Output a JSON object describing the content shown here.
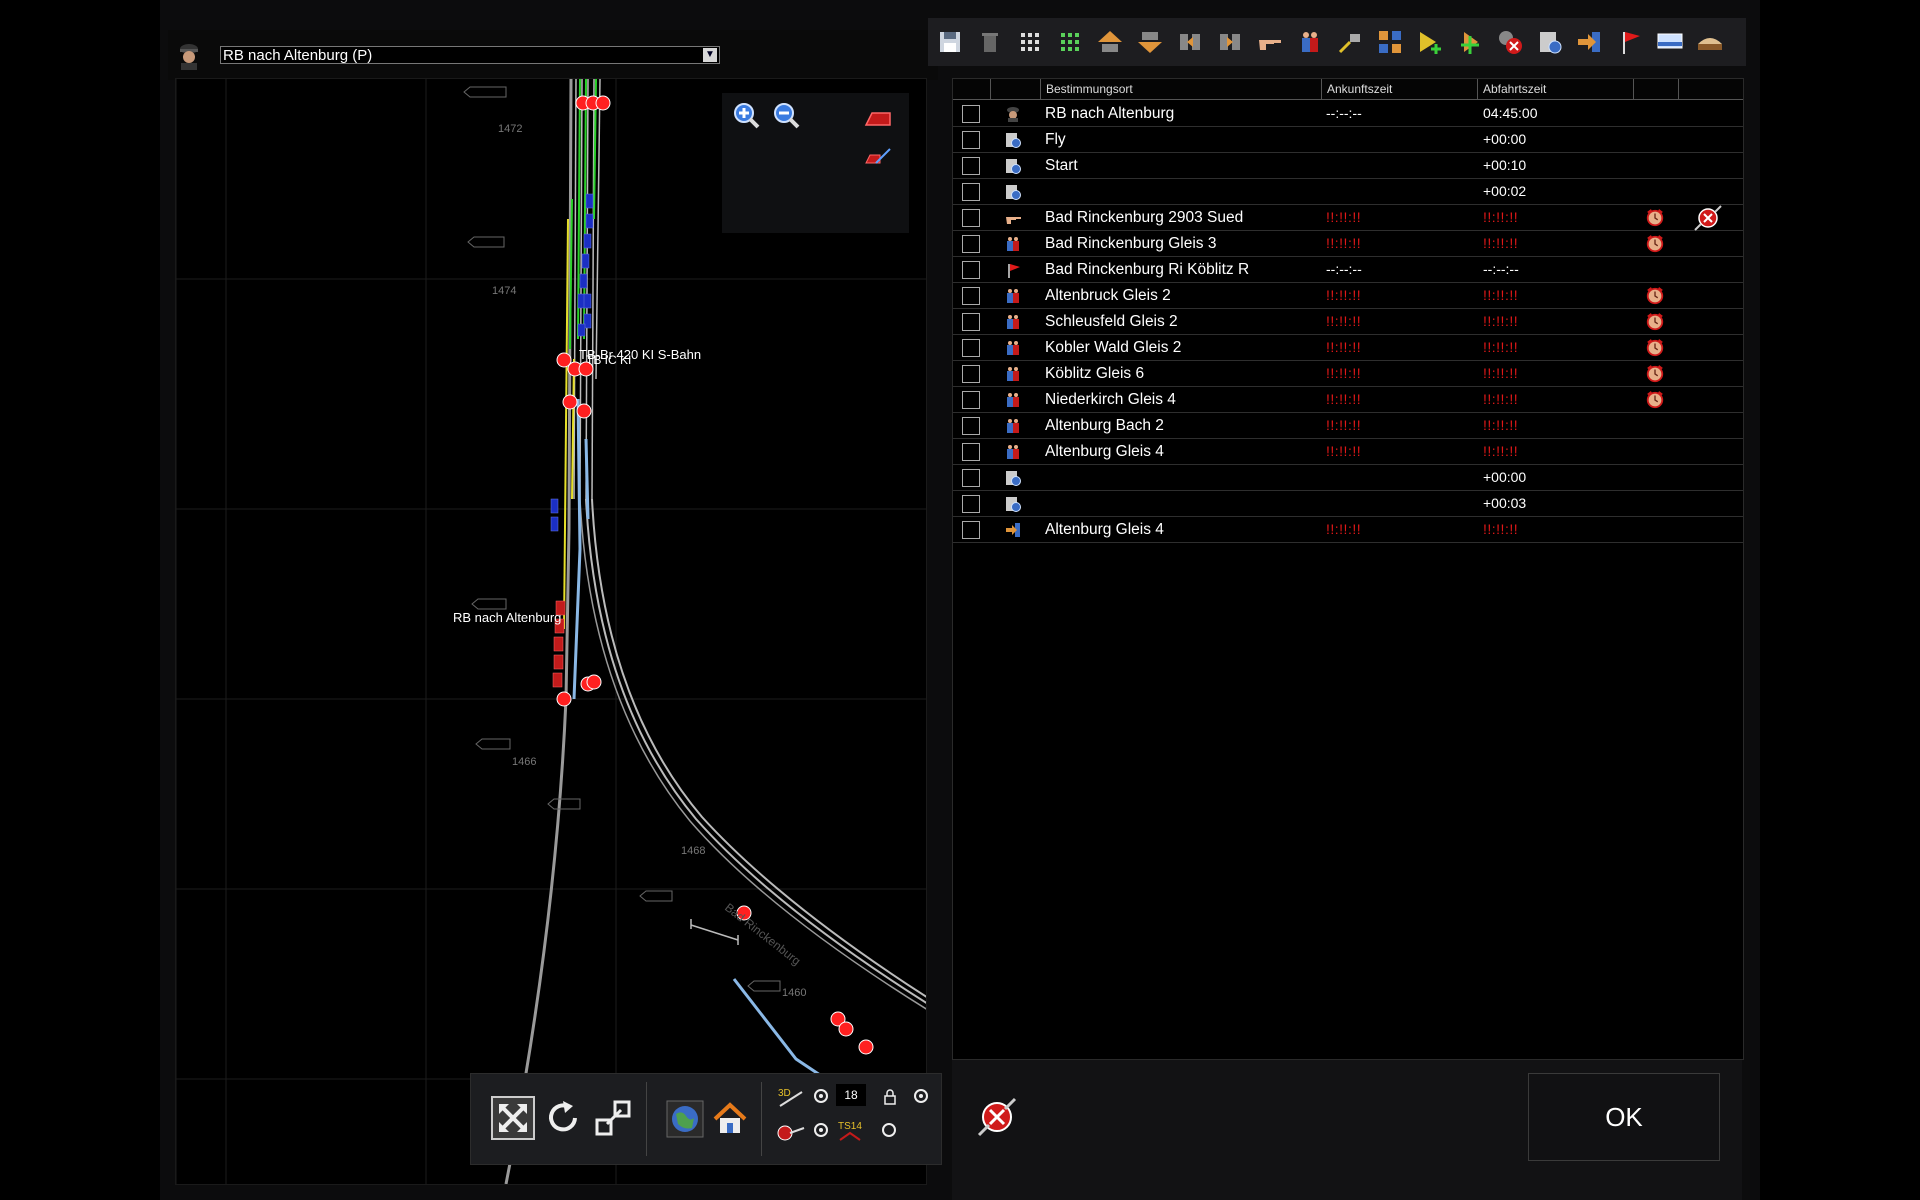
{
  "consist": {
    "selected": "RB nach Altenburg (P)"
  },
  "map": {
    "labels": {
      "train_rb": "RB nach Altenburg",
      "train_ic": "TB-Br 420 KI S-Bahn",
      "train_ic2": "TB IC KI",
      "place": "Bad Rinckenburg"
    },
    "toolbar": {
      "time_value": "18",
      "ts_label": "TS14",
      "threed_label": "3D"
    }
  },
  "timetable": {
    "headers": {
      "destination": "Bestimmungsort",
      "arrival": "Ankunftszeit",
      "departure": "Abfahrtszeit"
    },
    "rows": [
      {
        "icon": "driver-icon",
        "destination": "RB nach Altenburg",
        "arrival": "--:--:--",
        "departure": "04:45:00",
        "arr_error": false,
        "dep_error": false,
        "marker": ""
      },
      {
        "icon": "gear-instruction-icon",
        "destination": "Fly",
        "arrival": "",
        "departure": "+00:00",
        "arr_error": false,
        "dep_error": false,
        "marker": ""
      },
      {
        "icon": "gear-instruction-icon",
        "destination": "Start",
        "arrival": "",
        "departure": "+00:10",
        "arr_error": false,
        "dep_error": false,
        "marker": ""
      },
      {
        "icon": "gear-instruction-icon",
        "destination": "",
        "arrival": "",
        "departure": "+00:02",
        "arr_error": false,
        "dep_error": false,
        "marker": ""
      },
      {
        "icon": "pointing-hand-icon",
        "destination": "Bad Rinckenburg 2903 Sued",
        "arrival": "!!:!!:!!",
        "departure": "!!:!!:!!",
        "arr_error": true,
        "dep_error": true,
        "marker": "alarm-clock-icon"
      },
      {
        "icon": "passengers-icon",
        "destination": "Bad Rinckenburg Gleis 3",
        "arrival": "!!:!!:!!",
        "departure": "!!:!!:!!",
        "arr_error": true,
        "dep_error": true,
        "marker": "alarm-clock-icon"
      },
      {
        "icon": "red-flag-icon",
        "destination": "Bad Rinckenburg Ri Köblitz R",
        "arrival": "--:--:--",
        "departure": "--:--:--",
        "arr_error": false,
        "dep_error": false,
        "marker": ""
      },
      {
        "icon": "passengers-icon",
        "destination": "Altenbruck Gleis 2",
        "arrival": "!!:!!:!!",
        "departure": "!!:!!:!!",
        "arr_error": true,
        "dep_error": true,
        "marker": "alarm-clock-icon"
      },
      {
        "icon": "passengers-icon",
        "destination": "Schleusfeld Gleis 2",
        "arrival": "!!:!!:!!",
        "departure": "!!:!!:!!",
        "arr_error": true,
        "dep_error": true,
        "marker": "alarm-clock-icon"
      },
      {
        "icon": "passengers-icon",
        "destination": "Kobler Wald  Gleis 2",
        "arrival": "!!:!!:!!",
        "departure": "!!:!!:!!",
        "arr_error": true,
        "dep_error": true,
        "marker": "alarm-clock-icon"
      },
      {
        "icon": "passengers-icon",
        "destination": "Köblitz Gleis 6",
        "arrival": "!!:!!:!!",
        "departure": "!!:!!:!!",
        "arr_error": true,
        "dep_error": true,
        "marker": "alarm-clock-icon"
      },
      {
        "icon": "passengers-icon",
        "destination": "Niederkirch Gleis 4",
        "arrival": "!!:!!:!!",
        "departure": "!!:!!:!!",
        "arr_error": true,
        "dep_error": true,
        "marker": "alarm-clock-icon"
      },
      {
        "icon": "passengers-icon",
        "destination": "Altenburg Bach 2",
        "arrival": "!!:!!:!!",
        "departure": "!!:!!:!!",
        "arr_error": true,
        "dep_error": true,
        "marker": ""
      },
      {
        "icon": "passengers-icon",
        "destination": "Altenburg Gleis 4",
        "arrival": "!!:!!:!!",
        "departure": "!!:!!:!!",
        "arr_error": true,
        "dep_error": true,
        "marker": ""
      },
      {
        "icon": "gear-instruction-icon",
        "destination": "",
        "arrival": "",
        "departure": "+00:00",
        "arr_error": false,
        "dep_error": false,
        "marker": ""
      },
      {
        "icon": "gear-instruction-icon",
        "destination": "",
        "arrival": "",
        "departure": "+00:03",
        "arr_error": false,
        "dep_error": false,
        "marker": ""
      },
      {
        "icon": "exit-arrow-icon",
        "destination": "Altenburg Gleis 4",
        "arrival": "!!:!!:!!",
        "departure": "!!:!!:!!",
        "arr_error": true,
        "dep_error": true,
        "marker": ""
      }
    ]
  },
  "dialog": {
    "ok_label": "OK"
  },
  "colors": {
    "error_red": "#e01818",
    "track_grey": "#bbbbbb",
    "marker_red": "#ff2020"
  }
}
